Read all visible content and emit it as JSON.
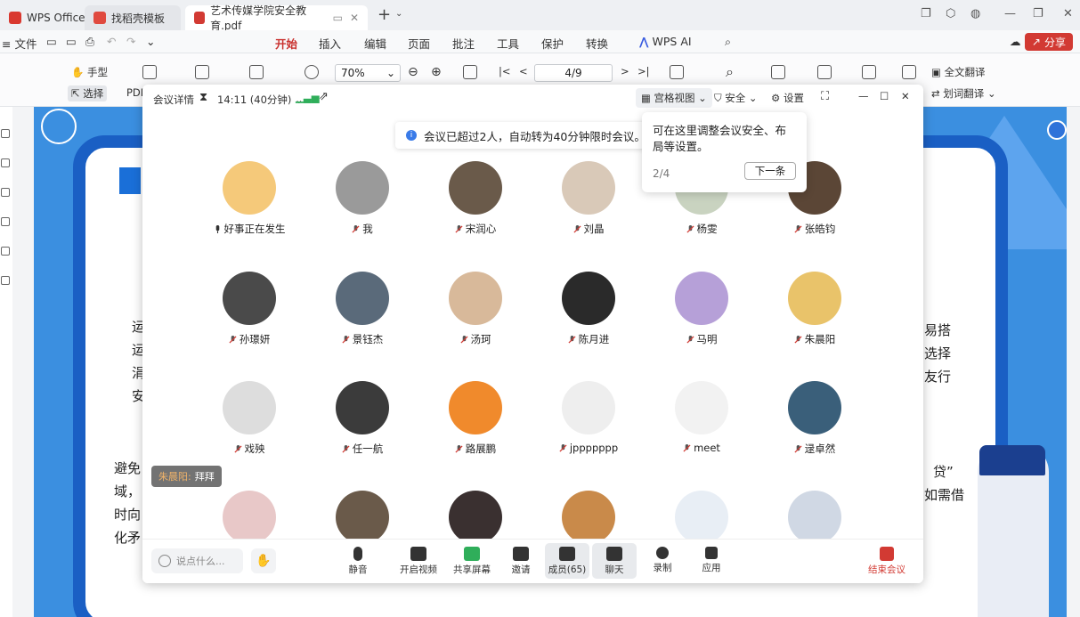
{
  "titlebar": {
    "tabs": [
      {
        "label": "WPS Office",
        "color": "#d9382f"
      },
      {
        "label": "找稻壳模板",
        "color": "#e04a3f"
      },
      {
        "label": "艺术传媒学院安全教育.pdf",
        "color": "#d23a33"
      }
    ]
  },
  "menubar": {
    "file": "文件",
    "items": [
      "开始",
      "插入",
      "编辑",
      "页面",
      "批注",
      "工具",
      "保护",
      "转换"
    ],
    "wps_ai": "WPS AI",
    "share": "分享"
  },
  "toolbar": {
    "hand": "手型",
    "select": "选择",
    "pdf": "PDF",
    "zoom": "70%",
    "page": "4/9",
    "full_translate": "全文翻译",
    "word_translate": "划词翻译"
  },
  "doc": {
    "left_lines": [
      "运",
      "运",
      "涓",
      "安"
    ],
    "right_lines": [
      "易搭",
      "选择",
      "友行"
    ],
    "bottom_left": [
      "避免",
      "域，",
      "时向",
      "化矛"
    ],
    "right_frag1": "贷”",
    "right_frag2": "如需借"
  },
  "meeting": {
    "details": "会议详情",
    "time": "14:11 (40分钟)",
    "grid_view": "宫格视图",
    "security": "安全",
    "settings": "设置",
    "notice": "会议已超过2人，自动转为40分钟限时会议。",
    "tip": {
      "text": "可在这里调整会议安全、布局等设置。",
      "count": "2/4",
      "next": "下一条"
    },
    "participants": [
      {
        "name": "好事正在发生",
        "color": "#f5c97a"
      },
      {
        "name": "我",
        "color": "#9a9a9a"
      },
      {
        "name": "宋润心",
        "color": "#6a5a4a"
      },
      {
        "name": "刘晶",
        "color": "#d9c9b8"
      },
      {
        "name": "杨雯",
        "color": "#c9d3c0"
      },
      {
        "name": "张皓钧",
        "color": "#5b4636"
      },
      {
        "name": "孙璟妍",
        "color": "#4a4a4a"
      },
      {
        "name": "景钰杰",
        "color": "#5a6a7a"
      },
      {
        "name": "汤珂",
        "color": "#d8b99a"
      },
      {
        "name": "陈月进",
        "color": "#2a2a2a"
      },
      {
        "name": "马明",
        "color": "#b6a0d8"
      },
      {
        "name": "朱晨阳",
        "color": "#e9c36a"
      },
      {
        "name": "戏殃",
        "color": "#dddddd"
      },
      {
        "name": "任一航",
        "color": "#3b3b3b"
      },
      {
        "name": "路展鹏",
        "color": "#f08a2c"
      },
      {
        "name": "jppppppp",
        "color": "#eeeeee"
      },
      {
        "name": "meet",
        "color": "#f2f2f2"
      },
      {
        "name": "逯卓然",
        "color": "#3a5f7a"
      },
      {
        "name": "",
        "color": "#e8c8c8"
      },
      {
        "name": "",
        "color": "#6a5a4a"
      },
      {
        "name": "",
        "color": "#3a3030"
      },
      {
        "name": "",
        "color": "#c98a4a"
      },
      {
        "name": "",
        "color": "#e8eef5"
      },
      {
        "name": "",
        "color": "#d0d8e4"
      }
    ],
    "chat": {
      "who": "朱晨阳:",
      "msg": "拜拜"
    },
    "bottom": {
      "say_placeholder": "说点什么...",
      "mute": "静音",
      "video": "开启视频",
      "share": "共享屏幕",
      "invite": "邀请",
      "members": "成员(65)",
      "chat": "聊天",
      "record": "录制",
      "apps": "应用",
      "end": "结束会议"
    }
  },
  "colors": {
    "brand_red": "#d23a33",
    "doc_blue": "#3b8fe0",
    "frame_blue": "#1a5fc4"
  }
}
